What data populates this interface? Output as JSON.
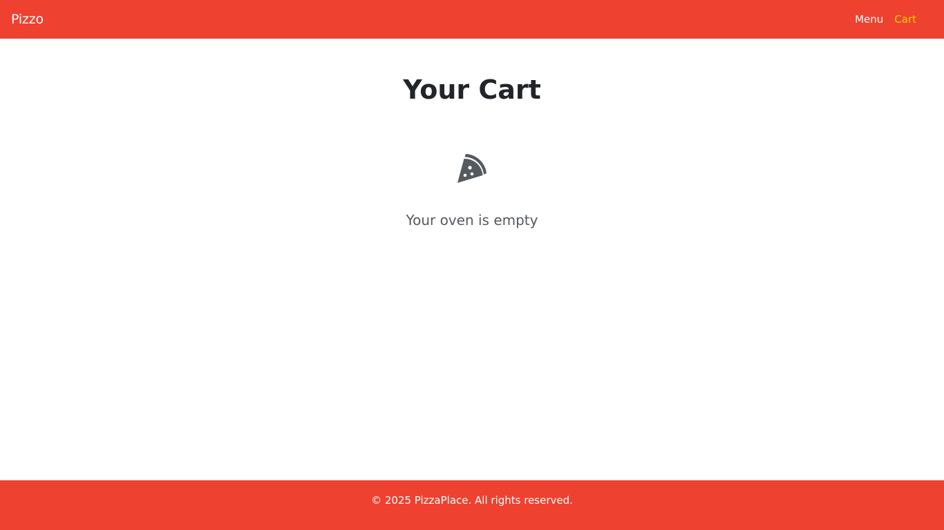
{
  "navbar": {
    "brand": "Pizzo",
    "links": [
      {
        "label": "Menu"
      },
      {
        "label": "Cart"
      }
    ],
    "background_color": "#ee4130",
    "active_link_color": "#ffd200"
  },
  "main": {
    "title": "Your Cart",
    "empty_icon": "pizza-slice-icon",
    "empty_message": "Your oven is empty"
  },
  "footer": {
    "text": "© 2025 PizzaPlace. All rights reserved."
  }
}
